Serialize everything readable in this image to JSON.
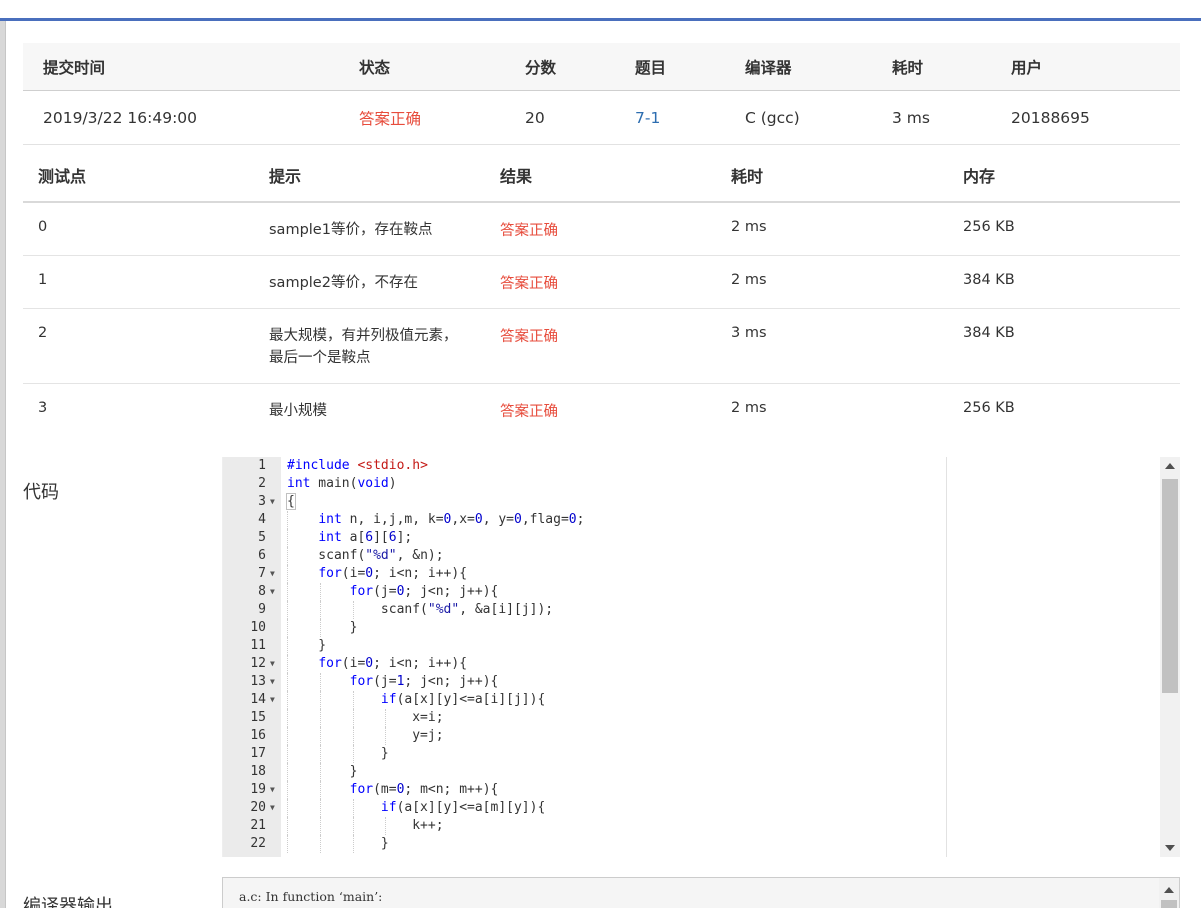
{
  "submission": {
    "headers": [
      "提交时间",
      "状态",
      "分数",
      "题目",
      "编译器",
      "耗时",
      "用户"
    ],
    "row": {
      "time": "2019/3/22 16:49:00",
      "status": "答案正确",
      "score": "20",
      "problem": "7-1",
      "compiler": "C (gcc)",
      "duration": "3 ms",
      "user": "20188695"
    }
  },
  "tests": {
    "headers": [
      "测试点",
      "提示",
      "结果",
      "耗时",
      "内存"
    ],
    "rows": [
      {
        "id": "0",
        "hint": "sample1等价，存在鞍点",
        "result": "答案正确",
        "time": "2 ms",
        "memory": "256 KB"
      },
      {
        "id": "1",
        "hint": "sample2等价，不存在",
        "result": "答案正确",
        "time": "2 ms",
        "memory": "384 KB"
      },
      {
        "id": "2",
        "hint": "最大规模，有并列极值元素，最后一个是鞍点",
        "result": "答案正确",
        "time": "3 ms",
        "memory": "384 KB"
      },
      {
        "id": "3",
        "hint": "最小规模",
        "result": "答案正确",
        "time": "2 ms",
        "memory": "256 KB"
      }
    ]
  },
  "code": {
    "label": "代码",
    "lines": [
      "#include <stdio.h>",
      "int main(void)",
      "{",
      "    int n, i,j,m, k=0,x=0, y=0,flag=0;",
      "    int a[6][6];",
      "    scanf(\"%d\", &n);",
      "    for(i=0; i<n; i++){",
      "        for(j=0; j<n; j++){",
      "            scanf(\"%d\", &a[i][j]);",
      "        }",
      "    }",
      "    for(i=0; i<n; i++){",
      "        for(j=1; j<n; j++){",
      "            if(a[x][y]<=a[i][j]){",
      "                x=i;",
      "                y=j;",
      "            }",
      "        }",
      "        for(m=0; m<n; m++){",
      "            if(a[x][y]<=a[m][y]){",
      "                k++;",
      "            }"
    ],
    "fold_lines": [
      3,
      7,
      8,
      12,
      13,
      14,
      19,
      20
    ]
  },
  "compiler_output": {
    "label": "编译器输出",
    "text": "a.c: In function ‘main’:"
  },
  "colors": {
    "status_ok": "#e74c3c",
    "link": "#2c6db0",
    "top_rule": "#4a6fbd"
  }
}
